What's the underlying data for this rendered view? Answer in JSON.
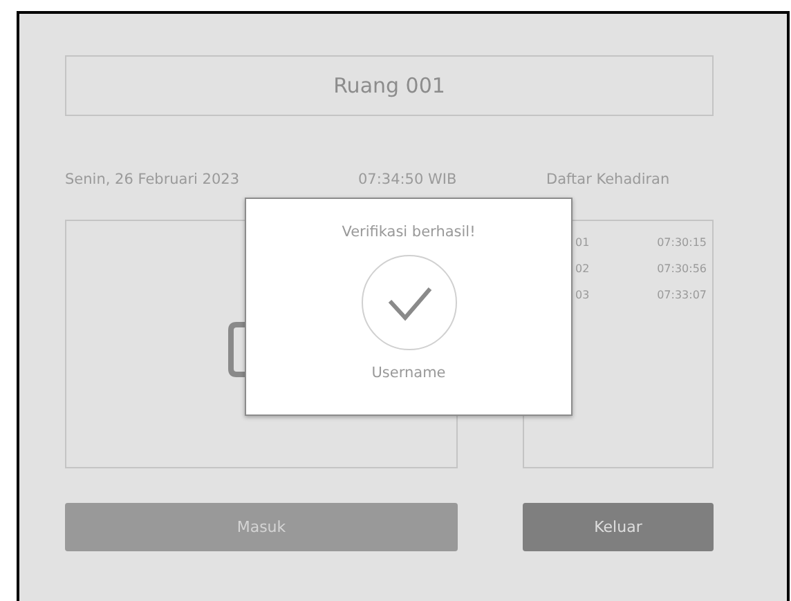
{
  "header": {
    "title": "Ruang 001"
  },
  "info": {
    "date": "Senin, 26 Februari 2023",
    "time": "07:34:50 WIB",
    "list_title": "Daftar Kehadiran"
  },
  "attendance": [
    {
      "id": "01",
      "time": "07:30:15"
    },
    {
      "id": "02",
      "time": "07:30:56"
    },
    {
      "id": "03",
      "time": "07:33:07"
    }
  ],
  "buttons": [
    {
      "label": "Masuk",
      "disabled": true
    },
    {
      "label": "Keluar",
      "disabled": false
    }
  ],
  "dialog": {
    "title": "Verifikasi berhasil!",
    "user": "Username"
  }
}
